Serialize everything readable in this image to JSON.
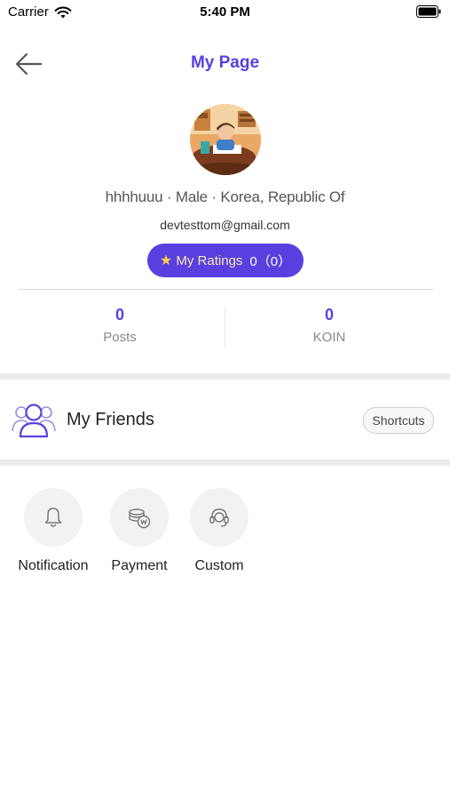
{
  "status_bar": {
    "carrier": "Carrier",
    "time": "5:40 PM"
  },
  "nav": {
    "title": "My Page"
  },
  "profile": {
    "summary": "hhhhuuu · Male · Korea, Republic Of",
    "email": "devtesttom@gmail.com",
    "ratings_label": "My Ratings",
    "ratings_value": "0（0）"
  },
  "stats": [
    {
      "value": "0",
      "label": "Posts"
    },
    {
      "value": "0",
      "label": "KOIN"
    }
  ],
  "friends": {
    "title": "My Friends",
    "shortcuts_label": "Shortcuts"
  },
  "menu": [
    {
      "label": "Notification",
      "icon": "bell-icon"
    },
    {
      "label": "Payment",
      "icon": "coins-icon"
    },
    {
      "label": "Custom",
      "icon": "headset-icon"
    }
  ],
  "colors": {
    "accent": "#5a3fe0",
    "band": "#ececec",
    "star": "#ffd34a"
  }
}
